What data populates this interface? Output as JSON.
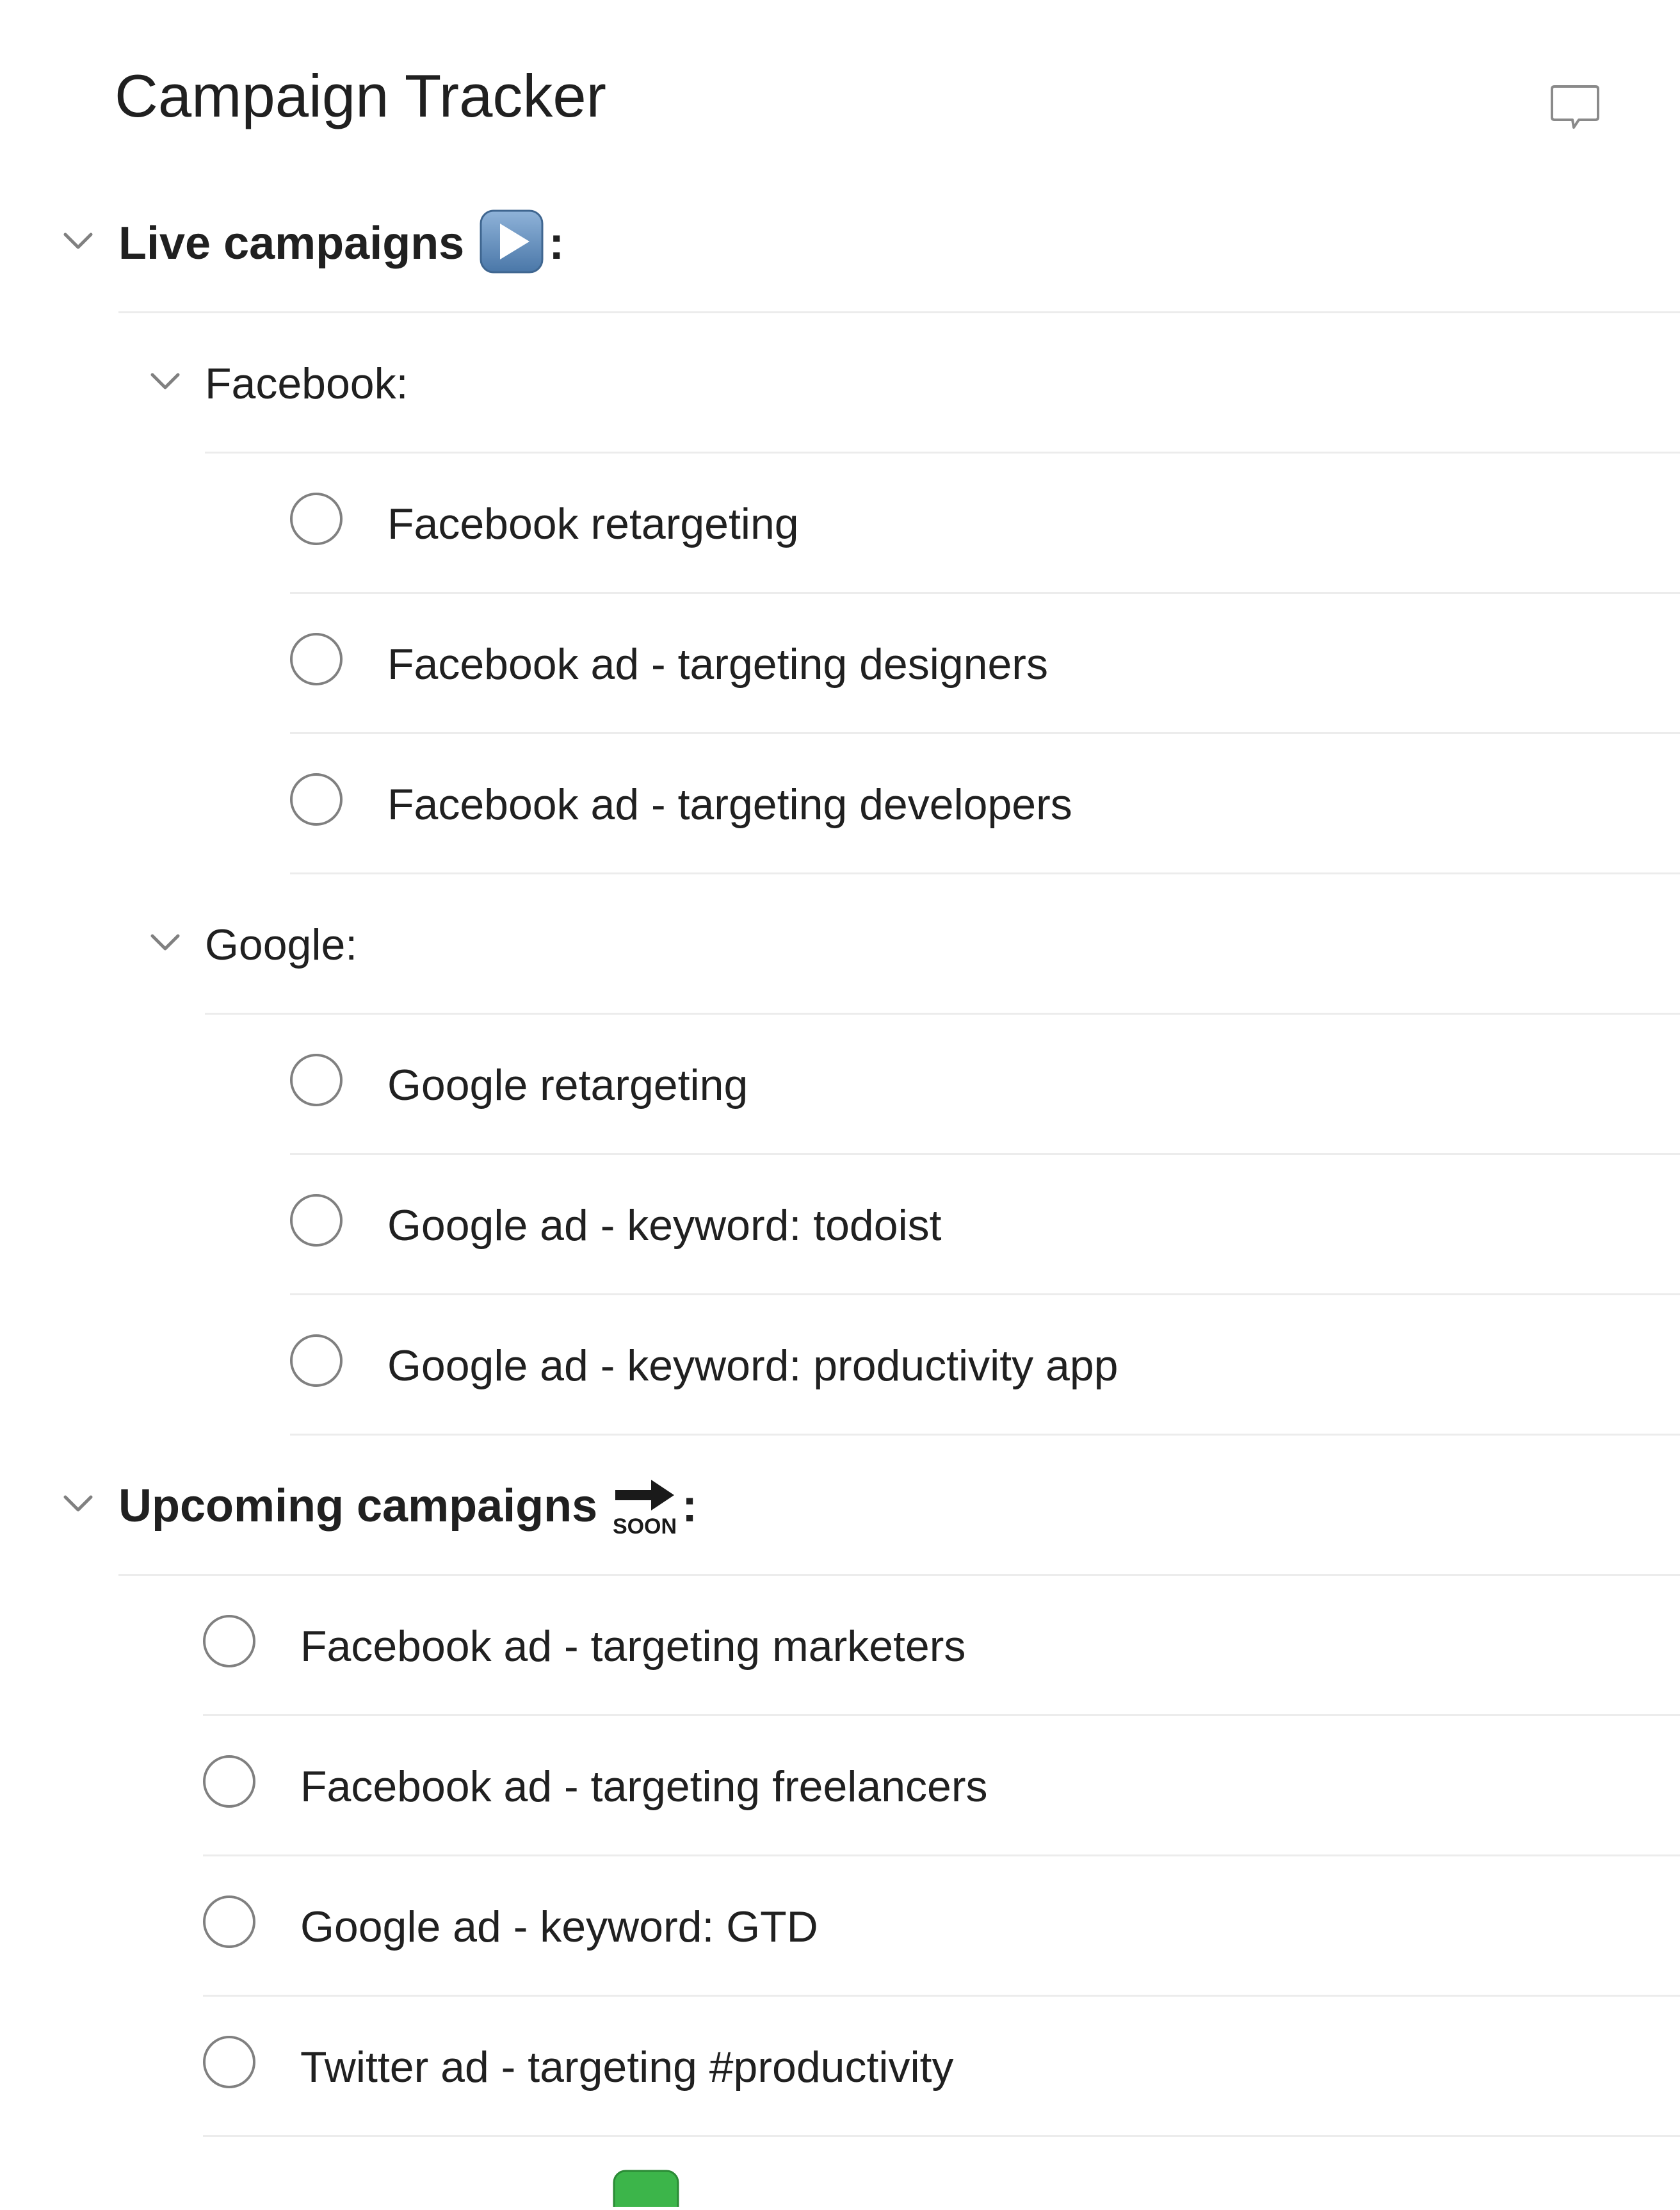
{
  "page": {
    "title": "Campaign Tracker"
  },
  "header": {
    "comment_icon": "comment-icon"
  },
  "sections": {
    "live": {
      "label": "Live campaigns",
      "emoji": "play-button-icon",
      "suffix": ":",
      "groups": {
        "facebook": {
          "label": "Facebook:",
          "tasks": [
            "Facebook retargeting",
            "Facebook ad - targeting designers",
            "Facebook ad - targeting developers"
          ]
        },
        "google": {
          "label": "Google:",
          "tasks": [
            "Google retargeting",
            "Google ad - keyword: todoist",
            "Google ad - keyword: productivity app"
          ]
        }
      }
    },
    "upcoming": {
      "label": "Upcoming campaigns",
      "emoji": "soon-arrow-icon",
      "emoji_text": "SOON",
      "suffix": ":",
      "tasks": [
        "Facebook ad - targeting marketers",
        "Facebook ad - targeting freelancers",
        "Google ad - keyword: GTD",
        "Twitter ad - targeting #productivity"
      ]
    }
  },
  "colors": {
    "text": "#202020",
    "divider": "#ececec",
    "checkbox_border": "#808080",
    "chevron": "#808080",
    "play_emoji_bg": "#5b86b4",
    "partial_emoji": "#3cb54a"
  }
}
